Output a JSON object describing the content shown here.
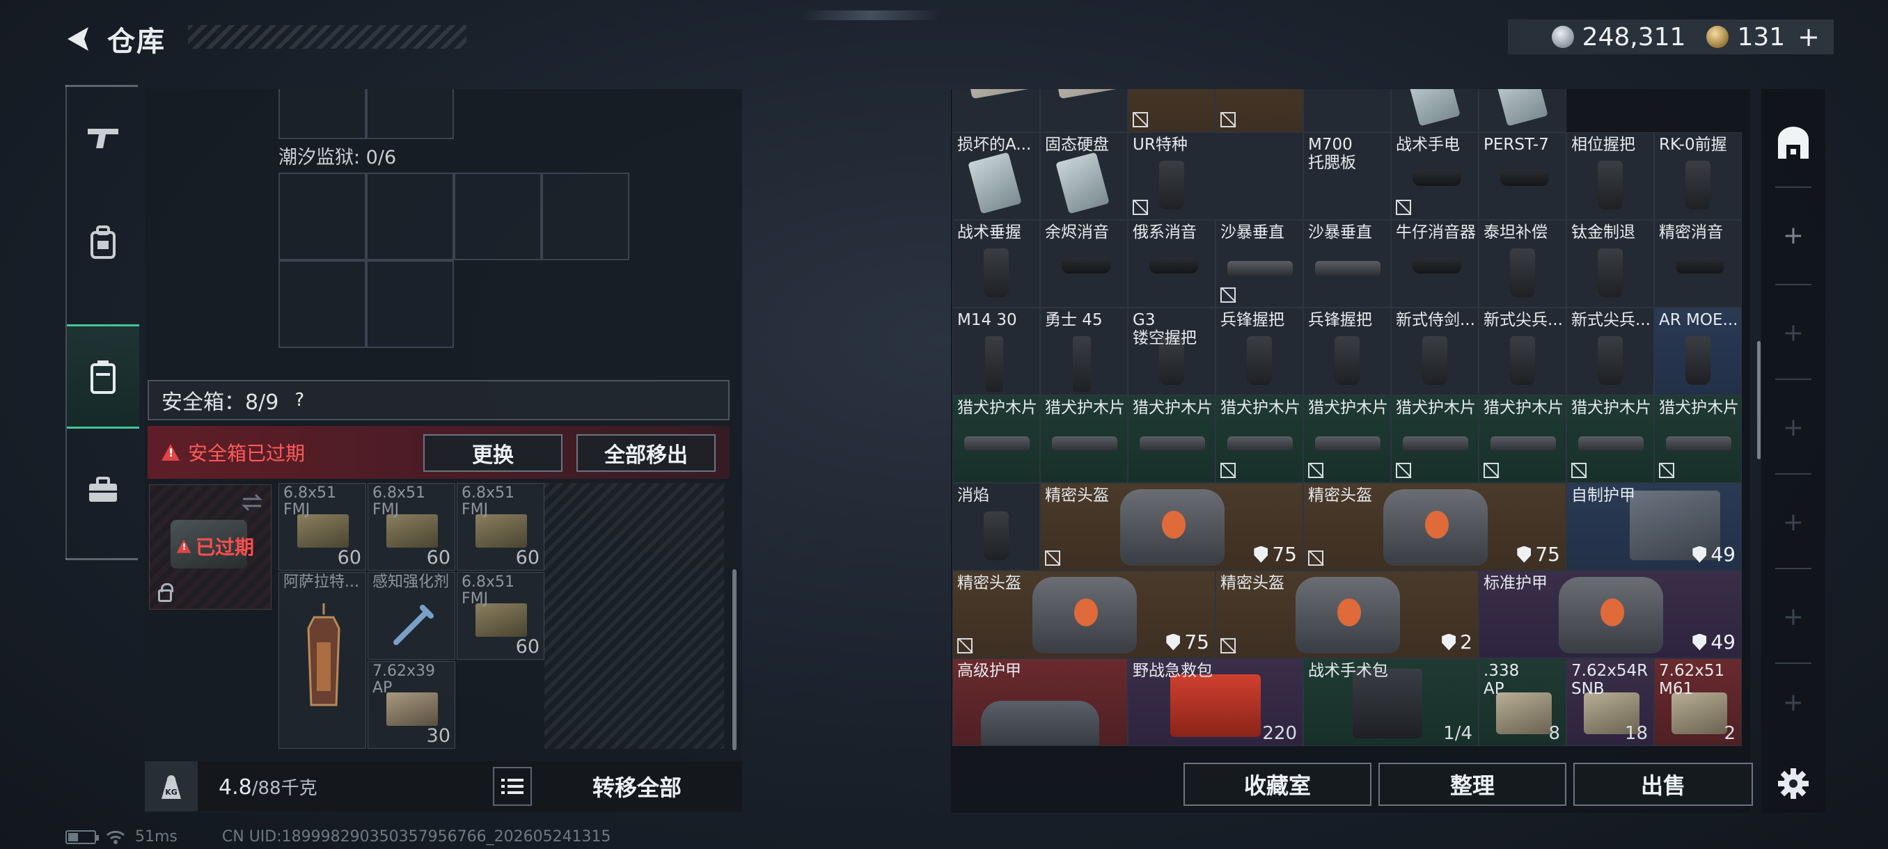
{
  "header": {
    "title": "仓库"
  },
  "currency": {
    "silver": "248,311",
    "gold": "131",
    "add": "+"
  },
  "left": {
    "prison_label": "潮汐监狱: 0/6",
    "safebox_label": "安全箱：8/9",
    "help": "?",
    "expired_text": "安全箱已过期",
    "replace_btn": "更换",
    "move_all_btn": "全部移出",
    "case_expired": "已过期",
    "safe_items": [
      {
        "name": "6.8x51",
        "name2": "FMJ",
        "count": "60"
      },
      {
        "name": "6.8x51",
        "name2": "FMJ",
        "count": "60"
      },
      {
        "name": "6.8x51",
        "name2": "FMJ",
        "count": "60"
      },
      {
        "name": "阿萨拉特...",
        "name2": "",
        "count": ""
      },
      {
        "name": "感知强化剂",
        "name2": "",
        "count": ""
      },
      {
        "name": "6.8x51",
        "name2": "FMJ",
        "count": "60"
      },
      {
        "name": "7.62x39",
        "name2": "AP",
        "count": "30"
      }
    ],
    "weight": "4.8",
    "weight_max": "/88千克",
    "transfer_all": "转移全部"
  },
  "inventory": {
    "rows": [
      [
        {
          "name": "",
          "style": "",
          "nosell": false,
          "art": "doc"
        },
        {
          "name": "",
          "style": "",
          "nosell": false,
          "art": "doc"
        },
        {
          "name": "",
          "style": "brown",
          "nosell": true,
          "art": "box"
        },
        {
          "name": "",
          "style": "brown",
          "nosell": true,
          "art": "box"
        },
        {
          "name": "",
          "style": "",
          "nosell": false,
          "art": "box"
        },
        {
          "name": "",
          "style": "",
          "nosell": false,
          "art": "card"
        },
        {
          "name": "",
          "style": "",
          "nosell": false,
          "art": "card"
        }
      ],
      [
        {
          "name": "损坏的A...",
          "art": "card"
        },
        {
          "name": "固态硬盘",
          "art": "card"
        },
        {
          "name": "UR特种",
          "art": "grip",
          "nosell": true
        },
        {
          "name": "M700",
          "name2": "托腮板",
          "art": ""
        },
        {
          "name": "战术手电",
          "art": "supp",
          "nosell": true
        },
        {
          "name": "PERST-7",
          "art": "supp"
        },
        {
          "name": "相位握把",
          "art": "grip"
        },
        {
          "name": "RK-0前握",
          "art": "grip"
        }
      ],
      [
        {
          "name": "战术垂握",
          "art": "grip"
        },
        {
          "name": "余烬消音",
          "art": "supp"
        },
        {
          "name": "俄系消音",
          "art": "supp"
        },
        {
          "name": "沙暴垂直",
          "art": "bar",
          "nosell": true
        },
        {
          "name": "沙暴垂直",
          "art": "bar"
        },
        {
          "name": "牛仔消音器",
          "art": "supp"
        },
        {
          "name": "泰坦补偿",
          "art": "grip"
        },
        {
          "name": "钛金制退",
          "art": "grip"
        },
        {
          "name": "精密消音",
          "art": "supp"
        }
      ],
      [
        {
          "name": "M14 30",
          "art": "mag"
        },
        {
          "name": "勇士 45",
          "art": "mag"
        },
        {
          "name": "G3",
          "name2": "镂空握把",
          "art": "grip"
        },
        {
          "name": "兵锋握把",
          "art": "grip"
        },
        {
          "name": "兵锋握把",
          "art": "grip"
        },
        {
          "name": "新式侍剑...",
          "art": "grip"
        },
        {
          "name": "新式尖兵...",
          "art": "grip"
        },
        {
          "name": "新式尖兵...",
          "art": "grip"
        },
        {
          "name": "AR MOE...",
          "art": "grip",
          "style": "blue"
        }
      ],
      [
        {
          "name": "猎犬护木片",
          "style": "green",
          "art": "bar"
        },
        {
          "name": "猎犬护木片",
          "style": "green",
          "art": "bar"
        },
        {
          "name": "猎犬护木片",
          "style": "green",
          "art": "bar"
        },
        {
          "name": "猎犬护木片",
          "style": "green",
          "art": "bar",
          "nosell": true
        },
        {
          "name": "猎犬护木片",
          "style": "green",
          "art": "bar",
          "nosell": true
        },
        {
          "name": "猎犬护木片",
          "style": "green",
          "art": "bar",
          "nosell": true
        },
        {
          "name": "猎犬护木片",
          "style": "green",
          "art": "bar",
          "nosell": true
        },
        {
          "name": "猎犬护木片",
          "style": "green",
          "art": "bar",
          "nosell": true
        },
        {
          "name": "猎犬护木片",
          "style": "green",
          "art": "bar",
          "nosell": true
        }
      ]
    ],
    "big_items": [
      {
        "name": "消焰",
        "count": ""
      },
      {
        "name": "精密头盔",
        "count": "75"
      },
      {
        "name": "精密头盔",
        "count": "75"
      },
      {
        "name": "自制护甲",
        "count": "49"
      },
      {
        "name": "精密头盔",
        "count": "75"
      },
      {
        "name": "精密头盔",
        "count": "2"
      },
      {
        "name": "标准护甲",
        "count": "49"
      },
      {
        "name": "高级护甲",
        "count": ""
      },
      {
        "name": "野战急救包",
        "count": "220"
      },
      {
        "name": "战术手术包",
        "count": "1/4"
      },
      {
        "name": ".338",
        "name2": "AP",
        "count": "8"
      },
      {
        "name": "7.62x54R",
        "name2": "SNB",
        "count": "18"
      },
      {
        "name": "7.62x51",
        "name2": "M61",
        "count": "2"
      }
    ],
    "buttons": {
      "vault": "收藏室",
      "sort": "整理",
      "sell": "出售"
    }
  },
  "status": {
    "ping": "51ms",
    "uid": "CN UID:1899982903503579567​66_202605241315"
  },
  "colors": {
    "accent": "#43c59a",
    "danger": "#e04444"
  }
}
